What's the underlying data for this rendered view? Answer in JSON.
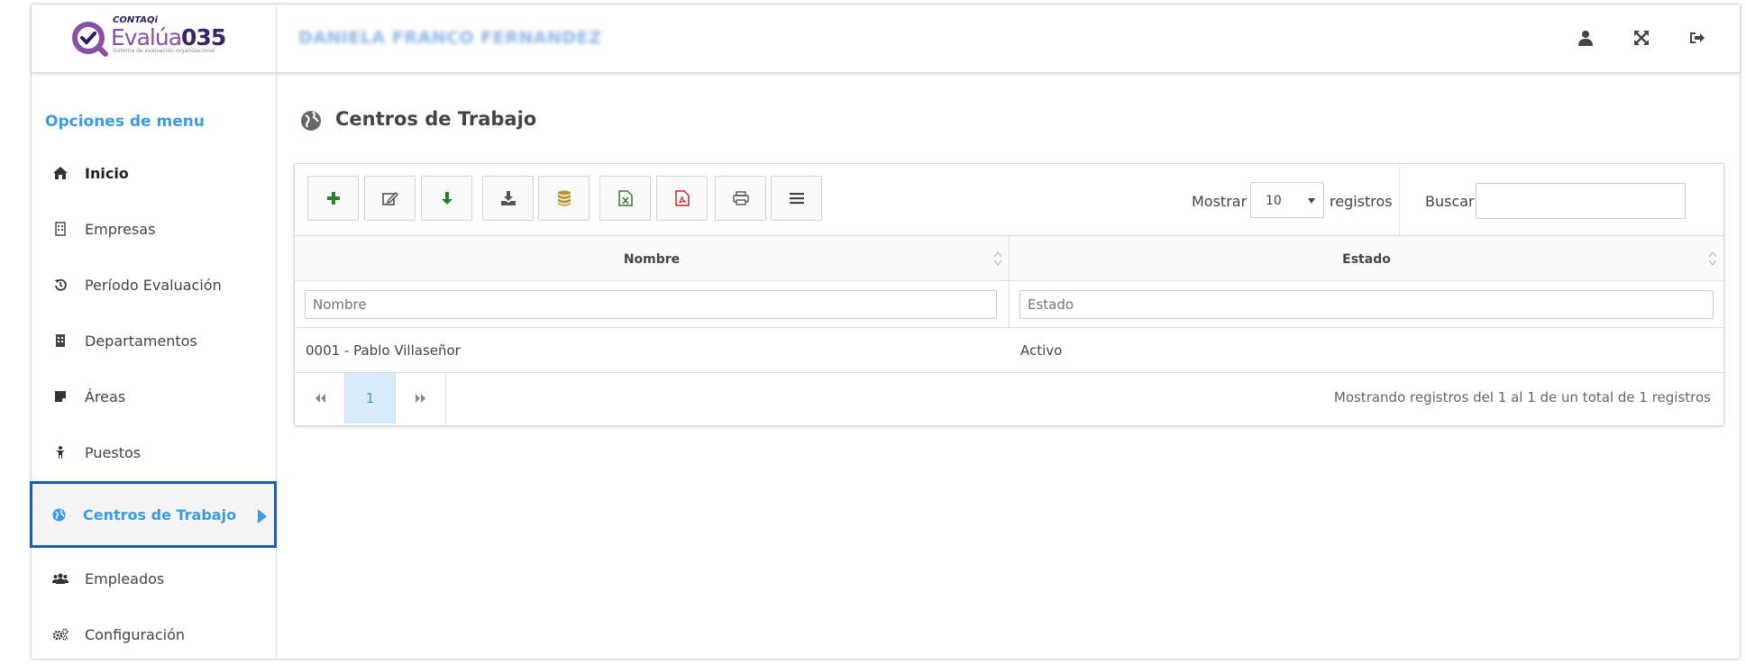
{
  "header": {
    "logo": {
      "brand": "CONTAQi",
      "product": "Evalúa035",
      "product_main": "Evalúa",
      "product_num": "035",
      "tagline": "Sistema de evaluación organizacional"
    },
    "user_name": "DANIELA FRANCO FERNANDEZ",
    "icons": [
      "user-icon",
      "fullscreen-icon",
      "logout-icon"
    ]
  },
  "sidebar": {
    "title": "Opciones de menu",
    "items": [
      {
        "label": "Inicio",
        "icon": "home-icon"
      },
      {
        "label": "Empresas",
        "icon": "building-icon"
      },
      {
        "label": "Período Evaluación",
        "icon": "history-icon"
      },
      {
        "label": "Departamentos",
        "icon": "building-icon"
      },
      {
        "label": "Áreas",
        "icon": "sticky-note-icon"
      },
      {
        "label": "Puestos",
        "icon": "person-icon"
      },
      {
        "label": "Centros de Trabajo",
        "icon": "globe-icon",
        "active": true
      },
      {
        "label": "Empleados",
        "icon": "users-icon"
      },
      {
        "label": "Configuración",
        "icon": "cogs-icon"
      }
    ]
  },
  "main": {
    "title": "Centros de Trabajo",
    "toolbar": {
      "buttons": [
        "add",
        "edit",
        "download-arrow",
        "download-tray",
        "database",
        "excel",
        "pdf",
        "print",
        "menu"
      ],
      "show_label": "Mostrar",
      "show_value": "10",
      "records_label": "registros",
      "search_label": "Buscar",
      "search_value": ""
    },
    "table": {
      "columns": [
        "Nombre",
        "Estado"
      ],
      "filters": [
        {
          "placeholder": "Nombre"
        },
        {
          "placeholder": "Estado"
        }
      ],
      "rows": [
        {
          "nombre": "0001 - Pablo Villaseñor",
          "estado": "Activo"
        }
      ]
    },
    "pager": {
      "current_page": "1",
      "info": "Mostrando registros del 1 al 1 de un total de 1 registros"
    }
  },
  "colors": {
    "accent": "#3b9be8",
    "active_border": "#1b5fb3",
    "green": "#2e7d32",
    "excel": "#2e7d32",
    "pdf": "#c62828",
    "gold": "#b8962e"
  }
}
